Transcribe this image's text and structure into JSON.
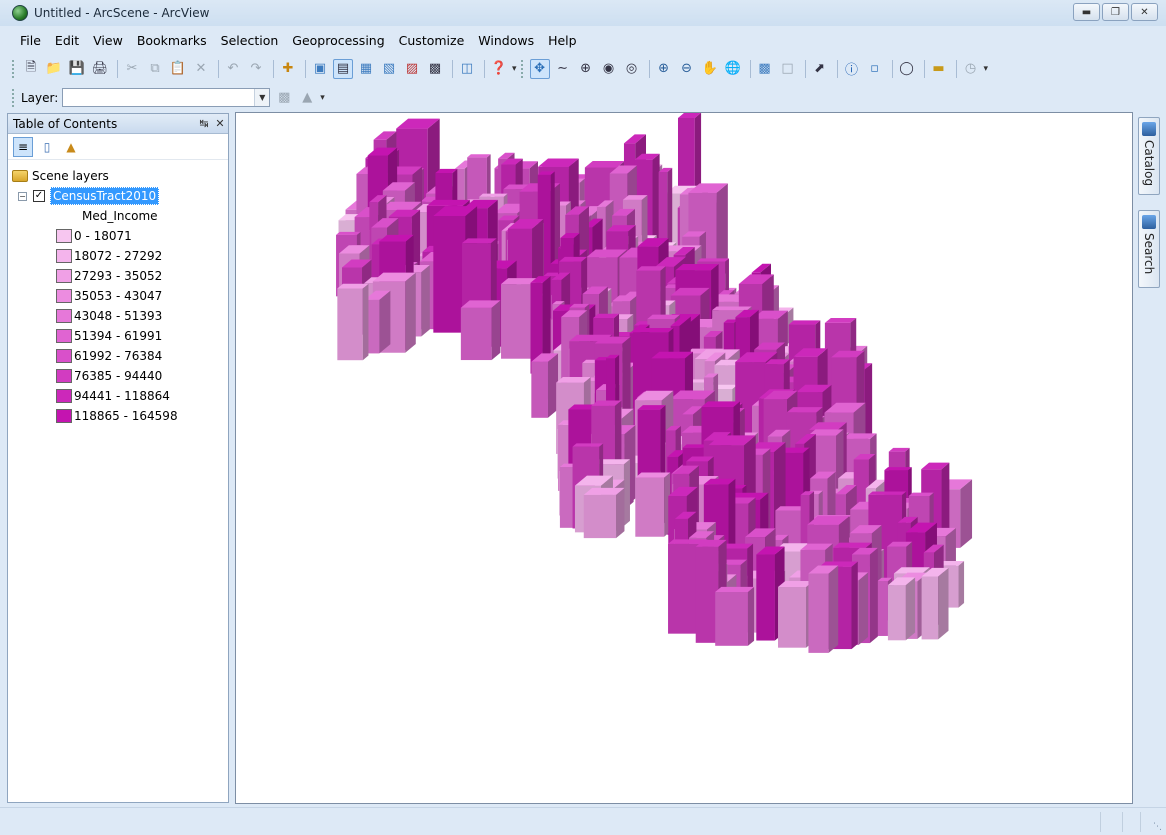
{
  "window": {
    "title": "Untitled - ArcScene - ArcView",
    "controls": [
      "minimize",
      "restore",
      "close"
    ]
  },
  "menu": [
    "File",
    "Edit",
    "View",
    "Bookmarks",
    "Selection",
    "Geoprocessing",
    "Customize",
    "Windows",
    "Help"
  ],
  "toolbar": {
    "layer_label": "Layer:",
    "layer_value": ""
  },
  "toc": {
    "title": "Table of Contents",
    "root": "Scene layers",
    "layer": {
      "name": "CensusTract2010",
      "checked": true,
      "field": "Med_Income",
      "classes": [
        {
          "label": "0 - 18071",
          "color": "#f7c6f0"
        },
        {
          "label": "18072 - 27292",
          "color": "#f4b4ec"
        },
        {
          "label": "27293 - 35052",
          "color": "#f0a0e6"
        },
        {
          "label": "35053 - 43047",
          "color": "#ec8ce0"
        },
        {
          "label": "43048 - 51393",
          "color": "#e678d9"
        },
        {
          "label": "51394 - 61991",
          "color": "#e064d2"
        },
        {
          "label": "61992 - 76384",
          "color": "#d950ca"
        },
        {
          "label": "76385 - 94440",
          "color": "#d23cc1"
        },
        {
          "label": "94441 - 118864",
          "color": "#cc28ba"
        },
        {
          "label": "118865 - 164598",
          "color": "#c414b0"
        }
      ]
    }
  },
  "dock": {
    "catalog": "Catalog",
    "search": "Search"
  }
}
